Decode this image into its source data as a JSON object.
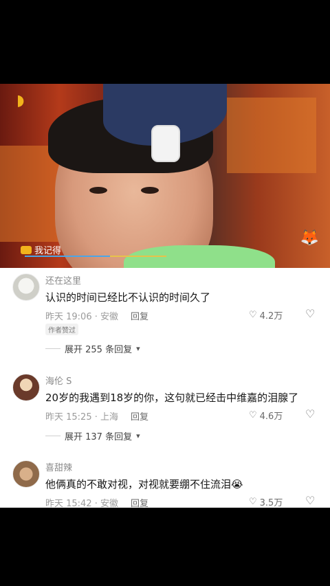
{
  "video": {
    "caption": "我记得"
  },
  "comments": [
    {
      "username": "还在这里",
      "text": "认识的时间已经比不认识的时间久了",
      "time": "昨天 19:06 · 安徽",
      "reply": "回复",
      "likes": "4.2万",
      "author_liked": "作者赞过",
      "expand": "展开 255 条回复"
    },
    {
      "username": "海伦 S",
      "text": "20岁的我遇到18岁的你，这句就已经击中维嘉的泪腺了",
      "time": "昨天 15:25 · 上海",
      "reply": "回复",
      "likes": "4.6万",
      "expand": "展开 137 条回复"
    },
    {
      "username": "喜甜辣",
      "text": "他俩真的不敢对视，对视就要绷不住流泪😭",
      "time": "昨天 15:42 · 安徽",
      "reply": "回复",
      "likes": "3.5万"
    }
  ],
  "icons": {
    "heart": "heart-icon",
    "dislike": "broken-heart-icon",
    "chevron": "chevron-down-icon"
  }
}
